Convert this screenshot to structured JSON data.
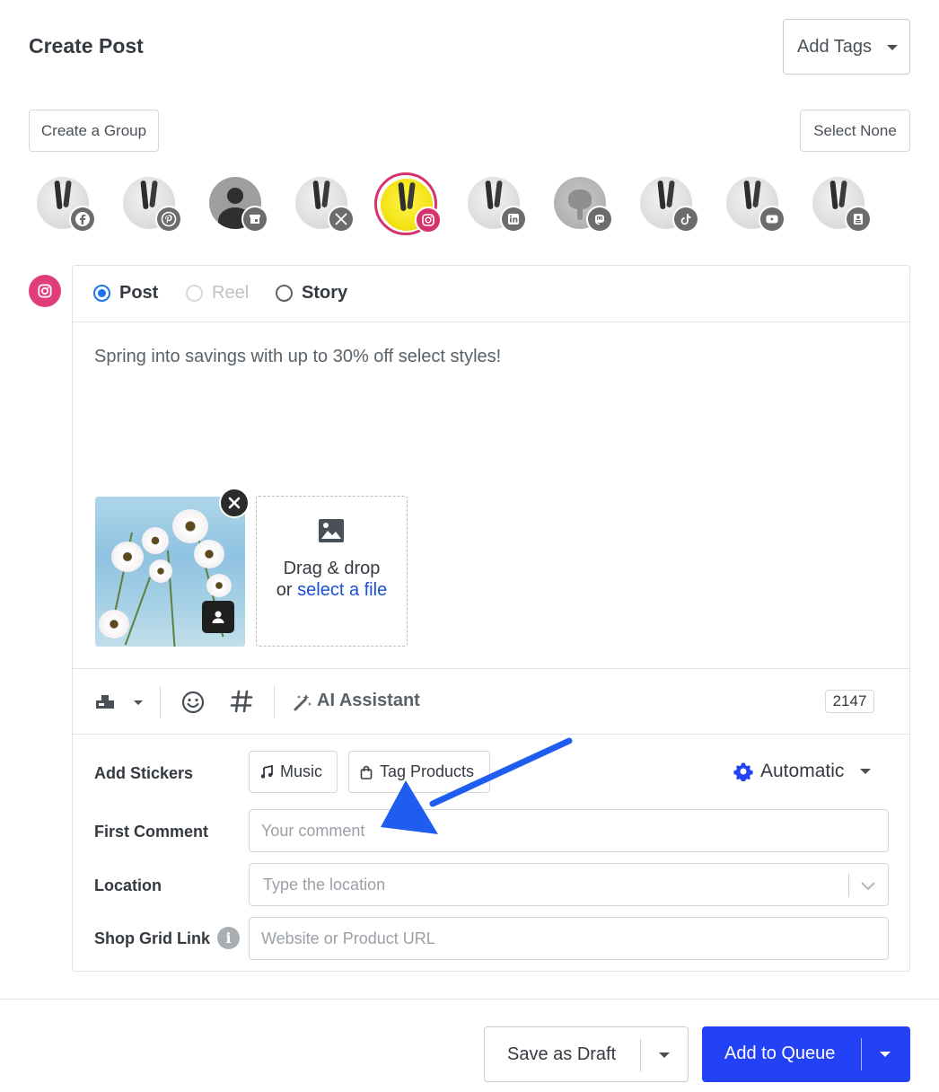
{
  "header": {
    "title": "Create Post",
    "add_tags_label": "Add Tags"
  },
  "groups": {
    "create_group_label": "Create a Group",
    "select_none_label": "Select None"
  },
  "accounts": [
    {
      "network": "facebook",
      "icon": "facebook-icon",
      "selected": false
    },
    {
      "network": "pinterest",
      "icon": "pinterest-icon",
      "selected": false
    },
    {
      "network": "google-business",
      "icon": "google-business-icon",
      "selected": false
    },
    {
      "network": "x",
      "icon": "x-icon",
      "selected": false
    },
    {
      "network": "instagram",
      "icon": "instagram-icon",
      "selected": true
    },
    {
      "network": "linkedin",
      "icon": "linkedin-icon",
      "selected": false
    },
    {
      "network": "mastodon",
      "icon": "mastodon-icon",
      "selected": false
    },
    {
      "network": "tiktok",
      "icon": "tiktok-icon",
      "selected": false
    },
    {
      "network": "youtube",
      "icon": "youtube-icon",
      "selected": false
    },
    {
      "network": "startpage",
      "icon": "startpage-icon",
      "selected": false
    }
  ],
  "post_type": {
    "options": [
      "Post",
      "Reel",
      "Story"
    ],
    "selected": "Post",
    "disabled": [
      "Reel"
    ]
  },
  "composer": {
    "text": "Spring into savings with up to 30% off select styles!",
    "dropzone_line1": "Drag & drop",
    "dropzone_or": "or",
    "dropzone_link": "select a file",
    "ai_assistant_label": "AI Assistant",
    "char_count": "2147"
  },
  "stickers": {
    "label": "Add Stickers",
    "music_label": "Music",
    "tag_products_label": "Tag Products",
    "mode_label": "Automatic"
  },
  "first_comment": {
    "label": "First Comment",
    "placeholder": "Your comment"
  },
  "location": {
    "label": "Location",
    "placeholder": "Type the location"
  },
  "shop_grid": {
    "label": "Shop Grid Link",
    "placeholder": "Website or Product URL"
  },
  "footer": {
    "save_draft_label": "Save as Draft",
    "add_queue_label": "Add to Queue"
  },
  "colors": {
    "instagram": "#d6336c",
    "primary": "#2342f5",
    "annotation_arrow": "#1f5cf0"
  }
}
